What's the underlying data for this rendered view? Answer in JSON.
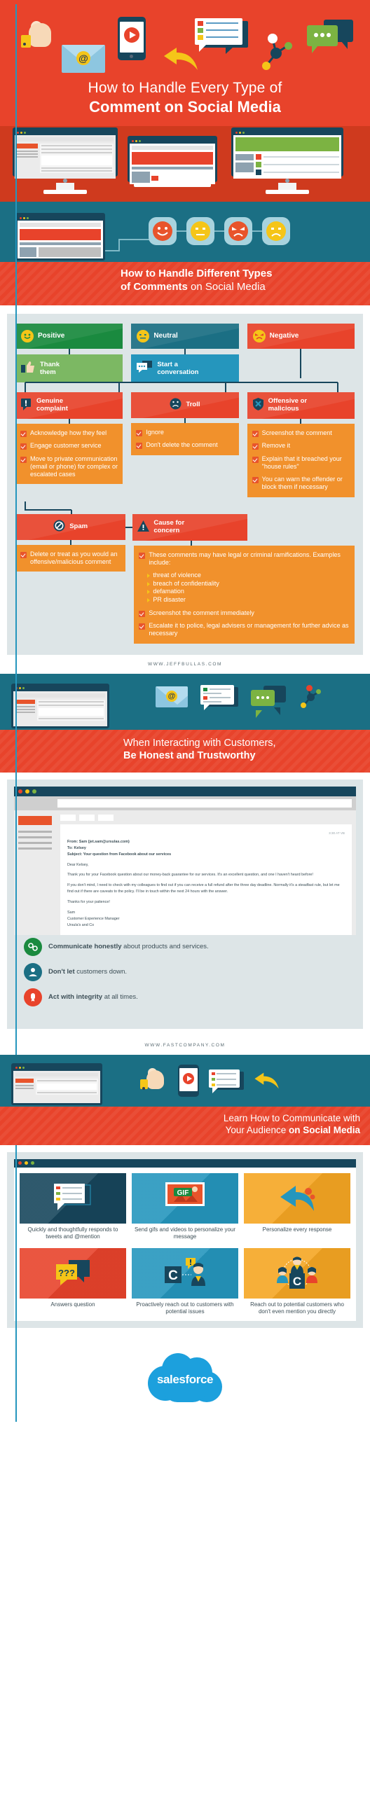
{
  "hero": {
    "title_line1": "How to Handle Every Type of",
    "title_line2": "Comment on Social Media",
    "icons": [
      "thumbs-up-icon",
      "email-envelope-icon",
      "mobile-video-icon",
      "comment-list-icon",
      "reply-arrow-icon",
      "network-molecule-icon",
      "speech-bubbles-icon"
    ],
    "bg_color": "#e8432b"
  },
  "section1": {
    "banner": {
      "heading_line1": "How to Handle Different Types",
      "heading_line2_bold": "of Comments",
      "heading_line2_rest": " on Social Media",
      "emoji_faces": [
        "happy-face",
        "neutral-face",
        "angry-face",
        "sad-face"
      ]
    },
    "flow": {
      "categories": [
        {
          "label": "Positive",
          "color": "#1a8a3f",
          "face": "happy-face",
          "action": {
            "label_line1": "Thank",
            "label_line2": "them",
            "color": "#7cb863",
            "icon": "thumbs-up-icon"
          }
        },
        {
          "label": "Neutral",
          "color": "#1b6f84",
          "face": "neutral-face",
          "action": {
            "label_line1": "Start a",
            "label_line2": "conversation",
            "color": "#2596bd",
            "icon": "chat-bubble-icon"
          }
        },
        {
          "label": "Negative",
          "color": "#e8432b",
          "face": "angry-face",
          "action": null
        }
      ],
      "branches": [
        {
          "title_line1": "Genuine",
          "title_line2": "complaint",
          "icon": "exclamation-bubble-icon",
          "items": [
            "Acknowledge how they feel",
            "Engage customer service",
            "Move to private communication (email or phone) for complex or escalated cases"
          ]
        },
        {
          "title_line1": "Troll",
          "title_line2": "",
          "icon": "troll-face-icon",
          "items": [
            "Ignore",
            "Don't delete the comment"
          ]
        },
        {
          "title_line1": "Offensive or",
          "title_line2": "malicious",
          "icon": "shield-x-icon",
          "items": [
            "Screenshot the comment",
            "Remove it",
            "Explain that it breached your \"house rules\"",
            "You can warn the offender or block them if necessary"
          ]
        }
      ],
      "branches2": [
        {
          "title_line1": "Spam",
          "title_line2": "",
          "icon": "no-entry-icon",
          "items": [
            "Delete or treat as you would an offensive/malicious comment"
          ]
        },
        {
          "title_line1": "Cause for",
          "title_line2": "concern",
          "icon": "warning-triangle-icon",
          "items": [
            "These comments may have legal or criminal ramifications. Examples include:",
            "Screenshot the comment immediately",
            "Escalate it to police, legal advisers or management for further advice as necessary"
          ],
          "sub_items": [
            "threat of violence",
            "breach of confidentiality",
            "defamation",
            "PR disaster"
          ]
        }
      ]
    },
    "source_url": "WWW.JEFFBULLAS.COM"
  },
  "section2": {
    "banner": {
      "heading_line1": "When Interacting with Customers,",
      "heading_line2": "Be Honest and Trustworthy",
      "icons": [
        "email-envelope-icon",
        "comment-list-icon",
        "speech-bubbles-icon",
        "network-molecule-icon"
      ]
    },
    "email": {
      "timestamp": "3:30 AT VB",
      "from": "From: Sam (jet.sam@ursulas.com)",
      "to": "To: Kelsey",
      "subject": "Subject: Your question from Facebook about our services",
      "greeting": "Dear Kelsey,",
      "body1": "Thank you for your Facebook question about our money-back guarantee for our services. It's an excellent question, and one I haven't heard before!",
      "body2": "If you don't mind, I need to check with my colleagues to find out if you can receive a full refund after the three day deadline. Normally it's a steadfast rule, but let me find out if there are caveats to the policy. I'll be in touch within the next 24 hours with the answer.",
      "closing": "Thanks for your patience!",
      "sign_name": "Sam",
      "sign_title": "Customer Experience Manager",
      "sign_company": "Ursula's and Co"
    },
    "points": [
      {
        "bold": "Communicate honestly",
        "rest": " about products and services.",
        "color": "#1a8a3f",
        "icon": "link-icon"
      },
      {
        "bold": "Don't let",
        "rest": " customers down.",
        "color": "#1b6f84",
        "icon": "person-icon"
      },
      {
        "bold": "Act with integrity",
        "rest": " at all times.",
        "color": "#e8432b",
        "icon": "badge-icon"
      }
    ],
    "source_url": "WWW.FASTCOMPANY.COM"
  },
  "section3": {
    "banner": {
      "heading_line1": "Learn How to Communicate with",
      "heading_line2_rest": "Your Audience ",
      "heading_line2_bold": "on Social Media",
      "icons": [
        "monitor-icon",
        "thumbs-up-icon",
        "mobile-video-icon",
        "comment-list-icon",
        "reply-arrow-icon"
      ]
    },
    "cards": [
      {
        "caption": "Quickly and thoughtfully responds to tweets and @mention",
        "color": "#17465c",
        "icon": "comment-list-icon",
        "caption_position": "below"
      },
      {
        "caption": "Send gifs and videos to personalize your message",
        "color": "#2596bd",
        "icon": "gif-image-icon",
        "caption_position": "below"
      },
      {
        "caption": "Personalize every response",
        "color": "#f5a623",
        "icon": "reply-arrow-icon",
        "caption_position": "below"
      },
      {
        "caption": "Answers question",
        "color": "#e8432b",
        "icon": "question-bubble-icon",
        "caption_position": "below"
      },
      {
        "caption": "Proactively reach out to customers with potential issues",
        "color": "#2596bd",
        "icon": "alert-person-icon",
        "caption_position": "below"
      },
      {
        "caption": "Reach out to potential customers who don't even mention you directly",
        "color": "#f5a623",
        "icon": "people-group-icon",
        "caption_position": "below"
      }
    ]
  },
  "footer": {
    "brand": "salesforce",
    "brand_color": "#1ca0dd"
  }
}
